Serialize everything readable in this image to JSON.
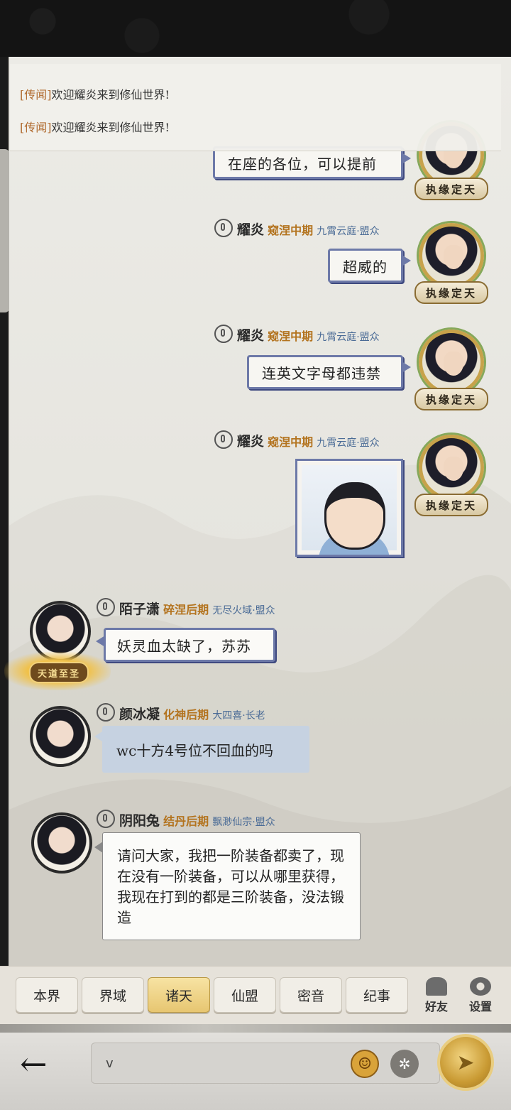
{
  "rumors": [
    {
      "tag": "[传闻]",
      "text": "欢迎耀炎来到修仙世界!"
    },
    {
      "tag": "[传闻]",
      "text": "欢迎耀炎来到修仙世界!"
    }
  ],
  "partial_message": {
    "text": "在座的各位，可以提前",
    "badge": "执缘定天"
  },
  "my_messages": [
    {
      "name": "耀炎",
      "realm": "窥涅中期",
      "guild": "九霄云庭·盟众",
      "text": "超威的",
      "badge": "执缘定天"
    },
    {
      "name": "耀炎",
      "realm": "窥涅中期",
      "guild": "九霄云庭·盟众",
      "text": "连英文字母都违禁",
      "badge": "执缘定天"
    },
    {
      "name": "耀炎",
      "realm": "窥涅中期",
      "guild": "九霄云庭·盟众",
      "text": "",
      "badge": "执缘定天"
    }
  ],
  "other_messages": [
    {
      "name": "陌子潇",
      "realm": "碎涅后期",
      "guild": "无尽火域·盟众",
      "text": "妖灵血太缺了，苏苏",
      "badge": "天道至圣"
    },
    {
      "name": "颜冰凝",
      "realm": "化神后期",
      "guild": "大四喜·长老",
      "text": "wc十方4号位不回血的吗"
    },
    {
      "name": "阴阳兔",
      "realm": "结丹后期",
      "guild": "飘渺仙宗·盟众",
      "text": "请问大家，我把一阶装备都卖了，现在没有一阶装备，可以从哪里获得，我现在打到的都是三阶装备，没法锻造"
    }
  ],
  "tabs": [
    "本界",
    "界域",
    "诸天",
    "仙盟",
    "密音",
    "纪事"
  ],
  "active_tab": "诸天",
  "side_buttons": {
    "friends": "好友",
    "settings": "设置"
  },
  "input": {
    "value": "v"
  },
  "colors": {
    "name_realm": "#b3731e",
    "guild": "#4a6b96",
    "bubble_border": "#6d79a8",
    "active_tab": "#e7c671"
  }
}
